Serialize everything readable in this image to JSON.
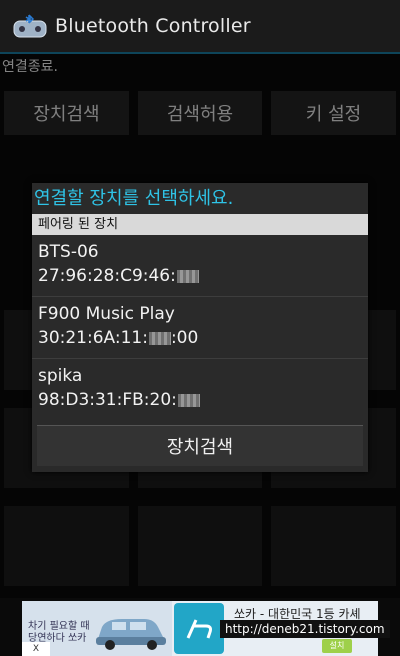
{
  "actionbar": {
    "title": "Bluetooth Controller",
    "icon": "bluetooth-controller-app-icon"
  },
  "status": {
    "text": "연결종료."
  },
  "top_buttons": [
    {
      "label": "장치검색"
    },
    {
      "label": "검색허용"
    },
    {
      "label": "키 설정"
    }
  ],
  "dialog": {
    "title": "연결할 장치를 선택하세요.",
    "section_header": "페어링 된 장치",
    "devices": [
      {
        "name": "BTS-06",
        "address": "27:96:28:C9:46:"
      },
      {
        "name": "F900 Music Play",
        "address_prefix": "30:21:6A:11:",
        "address_suffix": ":00"
      },
      {
        "name": "spika",
        "address": "98:D3:31:FB:20:"
      }
    ],
    "scan_button": "장치검색"
  },
  "ad": {
    "left_text_1": "차기 필요할 때",
    "left_text_2": "당연하다 쏘카",
    "title": "쏘카 - 대한민국 1등 카셰",
    "close_label": "X",
    "install_label": "설치"
  },
  "watermark": "http://deneb21.tistory.com"
}
